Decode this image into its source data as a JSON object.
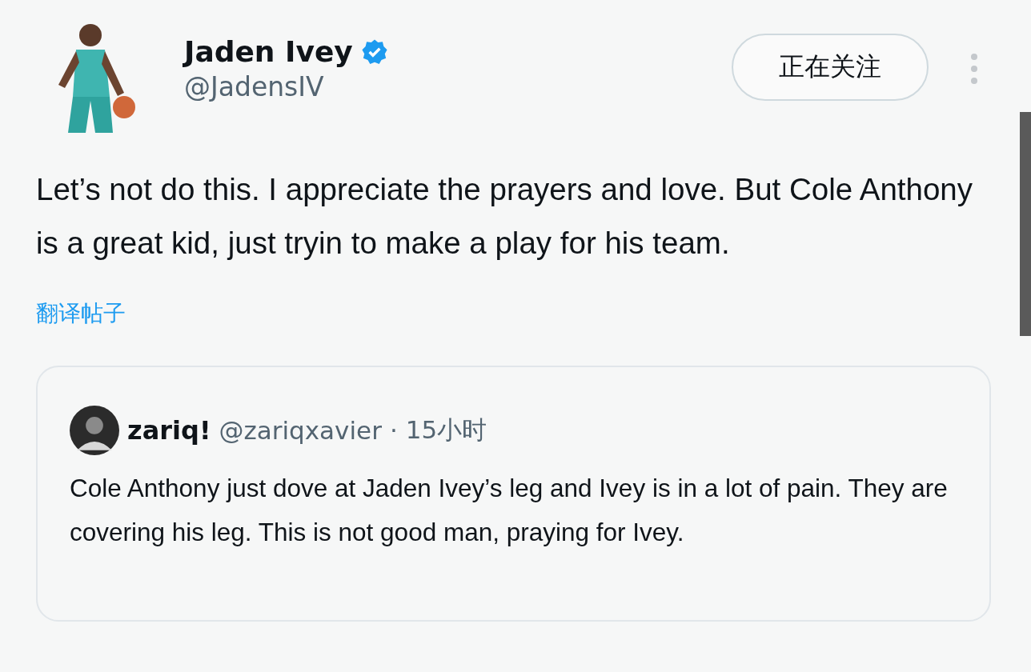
{
  "author": {
    "name": "Jaden Ivey",
    "verified": true,
    "handle": "@JadensIV"
  },
  "follow_button": {
    "label": "正在关注"
  },
  "post": {
    "text": "Let’s not do this. I appreciate the prayers and love. But Cole Anthony is a great kid, just tryin to make a play for his team.",
    "translate_link": "翻译帖子"
  },
  "quoted_post": {
    "name": "zariq!",
    "handle": "@zariqxavier",
    "separator": "·",
    "time": "15小时",
    "text": "Cole Anthony just dove at Jaden Ivey’s leg and Ivey is in a lot of pain. They are covering his leg. This is not good man, praying for Ivey."
  }
}
